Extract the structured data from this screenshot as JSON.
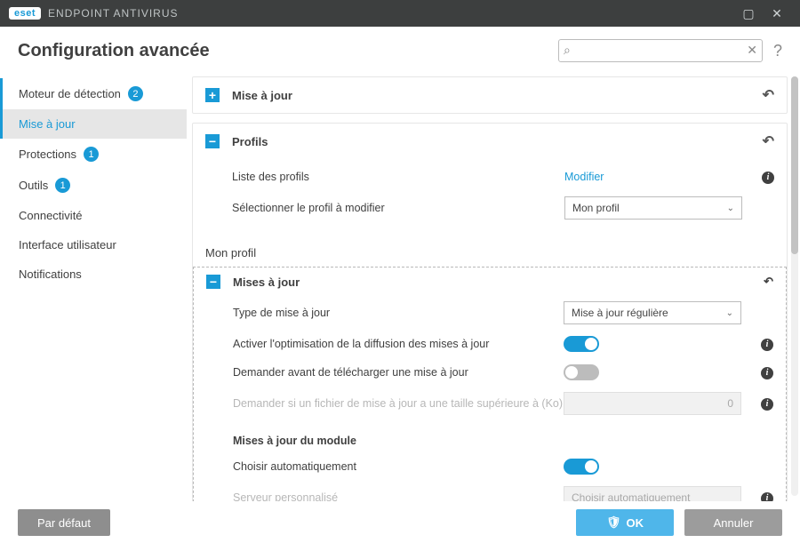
{
  "titlebar": {
    "brand": "eset",
    "product": "ENDPOINT ANTIVIRUS"
  },
  "header": {
    "title": "Configuration avancée",
    "search_placeholder": ""
  },
  "sidebar": {
    "items": [
      {
        "label": "Moteur de détection",
        "badge": "2"
      },
      {
        "label": "Mise à jour"
      },
      {
        "label": "Protections",
        "badge": "1"
      },
      {
        "label": "Outils",
        "badge": "1"
      },
      {
        "label": "Connectivité"
      },
      {
        "label": "Interface utilisateur"
      },
      {
        "label": "Notifications"
      }
    ]
  },
  "panels": {
    "update": {
      "title": "Mise à jour"
    },
    "profiles": {
      "title": "Profils",
      "list_label": "Liste des profils",
      "list_action": "Modifier",
      "select_label": "Sélectionner le profil à modifier",
      "select_value": "Mon profil"
    }
  },
  "profile_section": {
    "title": "Mon profil"
  },
  "sub": {
    "title": "Mises à jour",
    "type_label": "Type de mise à jour",
    "type_value": "Mise à jour régulière",
    "opt_label": "Activer l'optimisation de la diffusion des mises à jour",
    "ask_label": "Demander avant de télécharger une mise à jour",
    "size_label": "Demander si un fichier de mise à jour a une taille supérieure à (Ko)",
    "size_value": "0",
    "module_heading": "Mises à jour du module",
    "auto_label": "Choisir automatiquement",
    "server_label": "Serveur personnalisé",
    "server_value": "Choisir automatiquement"
  },
  "footer": {
    "default": "Par défaut",
    "ok": "OK",
    "cancel": "Annuler"
  }
}
